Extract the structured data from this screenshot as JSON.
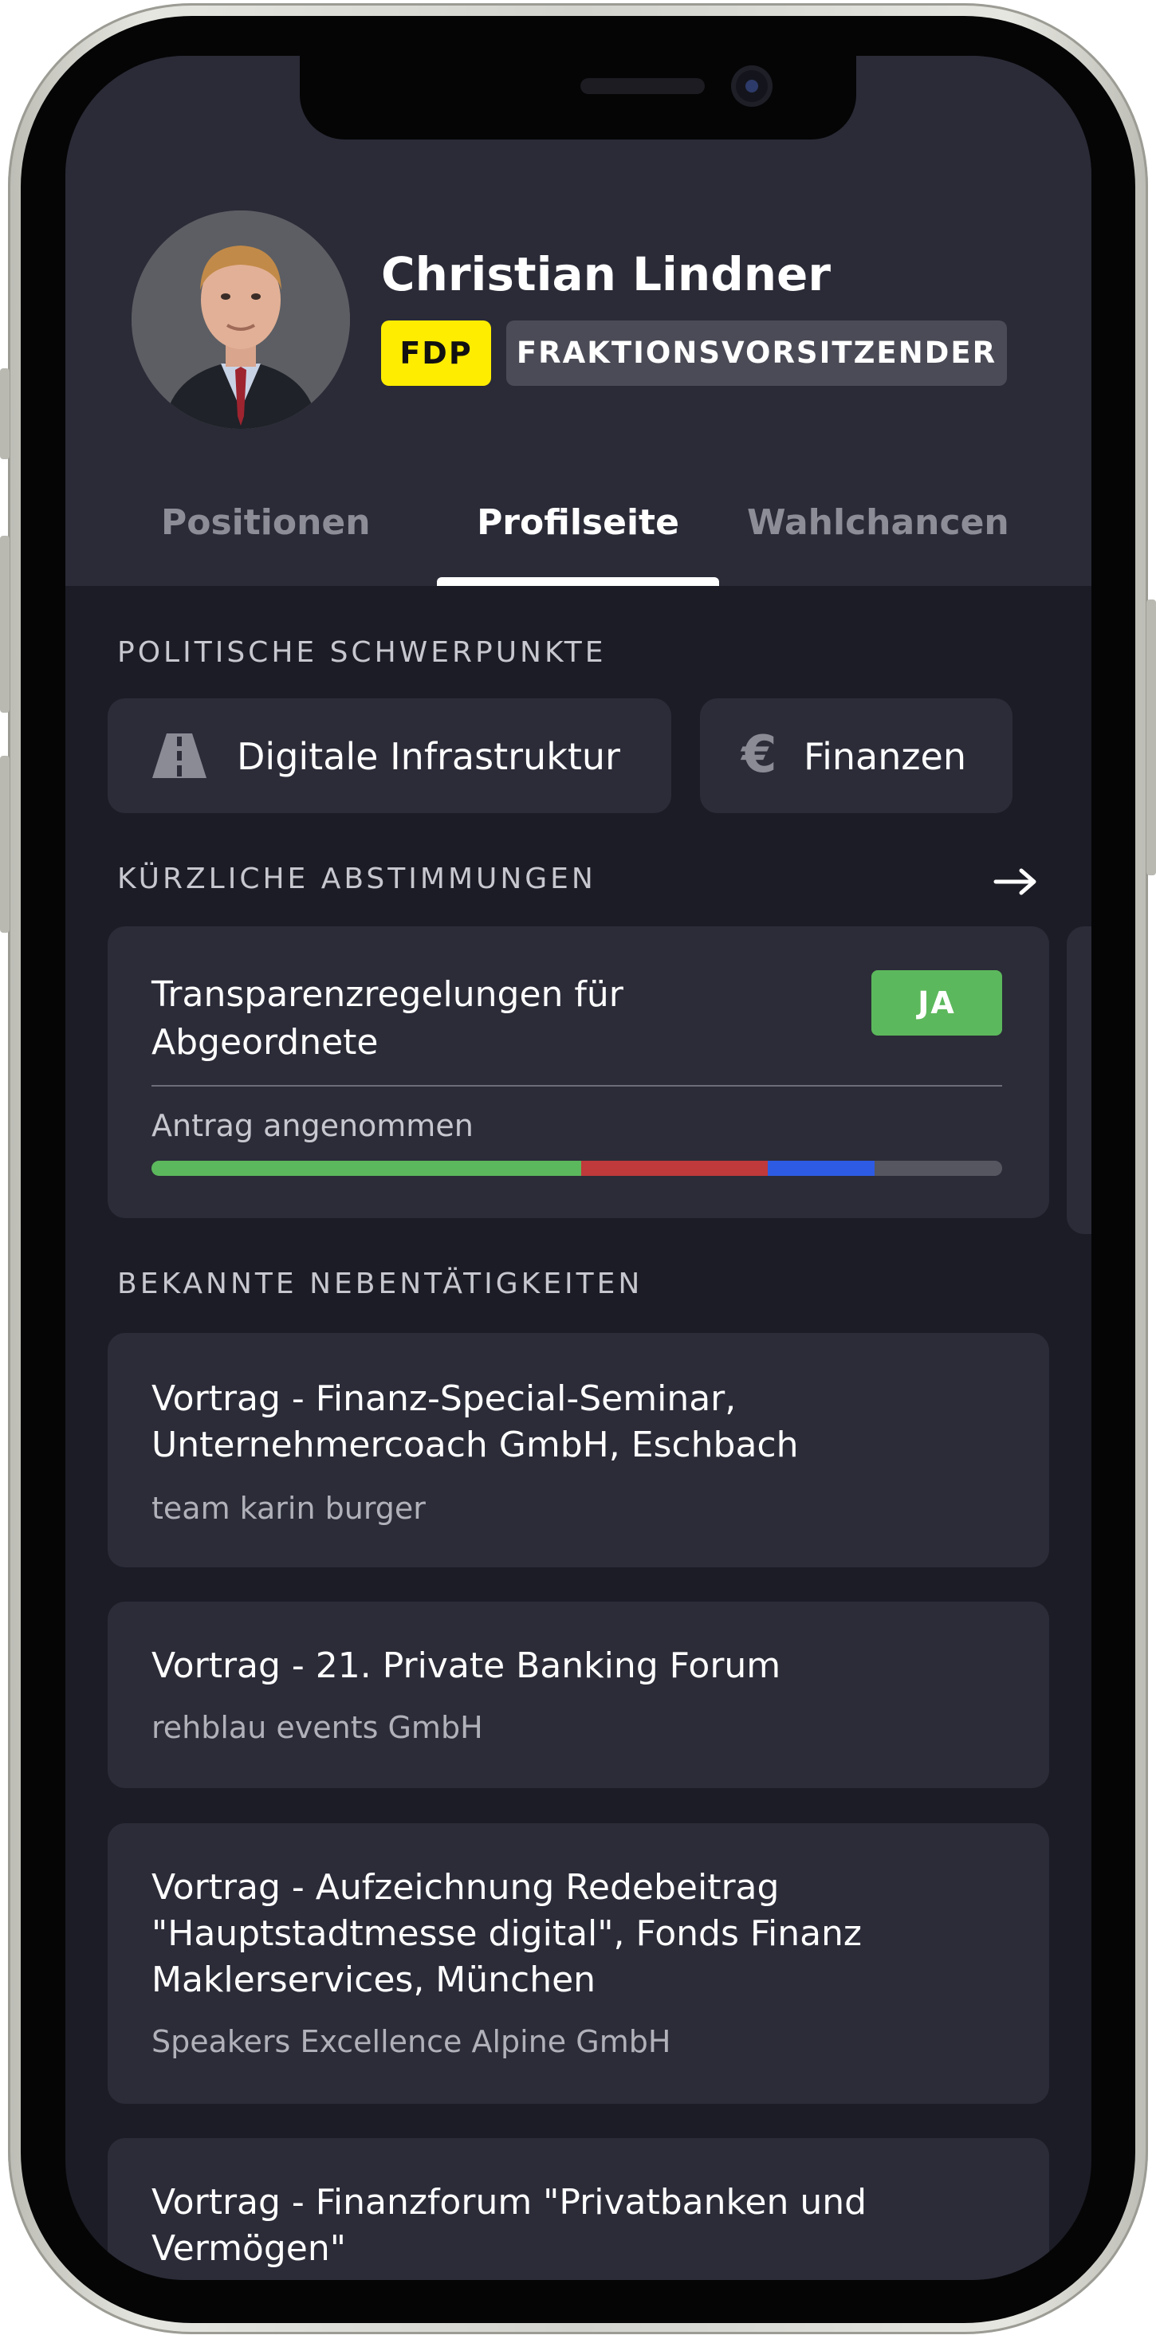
{
  "profile": {
    "name": "Christian Lindner",
    "party": "FDP",
    "role": "FRAKTIONSVORSITZENDER"
  },
  "tabs": [
    {
      "label": "Positionen",
      "active": false
    },
    {
      "label": "Profilseite",
      "active": true
    },
    {
      "label": "Wahlchancen",
      "active": false
    }
  ],
  "focus": {
    "heading": "POLITISCHE SCHWERPUNKTE",
    "chips": [
      {
        "label": "Digitale Infrastruktur",
        "icon": "road-icon"
      },
      {
        "label": "Finanzen",
        "icon": "euro-icon"
      }
    ]
  },
  "votes": {
    "heading": "KÜRZLICHE ABSTIMMUNGEN",
    "more_icon": "arrow-right-icon",
    "items": [
      {
        "title": "Transparenzregelungen für Abgeordnete",
        "result": "JA",
        "status": "Antrag angenommen",
        "distribution": [
          {
            "label": "yes",
            "fraction": 0.505,
            "color": "#5cb85c"
          },
          {
            "label": "no",
            "fraction": 0.219,
            "color": "#c0393b"
          },
          {
            "label": "abstain",
            "fraction": 0.126,
            "color": "#2d5be3"
          },
          {
            "label": "absent",
            "fraction": 0.15,
            "color": "#55565f"
          }
        ]
      }
    ]
  },
  "activities": {
    "heading": "BEKANNTE NEBENTÄTIGKEITEN",
    "items": [
      {
        "title": "Vortrag - Finanz-Special-Seminar, Unternehmercoach GmbH, Eschbach",
        "organizer": "team karin burger"
      },
      {
        "title": "Vortrag - 21. Private Banking Forum",
        "organizer": "rehblau events GmbH"
      },
      {
        "title": "Vortrag - Aufzeichnung Redebeitrag \"Hauptstadtmesse digital\", Fonds Finanz Maklerservices, München",
        "organizer": "Speakers Excellence Alpine GmbH"
      },
      {
        "title": "Vortrag - Finanzforum \"Privatbanken und Vermögen\"",
        "organizer": ""
      }
    ]
  },
  "colors": {
    "background": "#1b1c25",
    "header": "#2a2b37",
    "card": "#2b2c38",
    "party_yellow": "#ffed00",
    "yes_green": "#5cb85c"
  }
}
